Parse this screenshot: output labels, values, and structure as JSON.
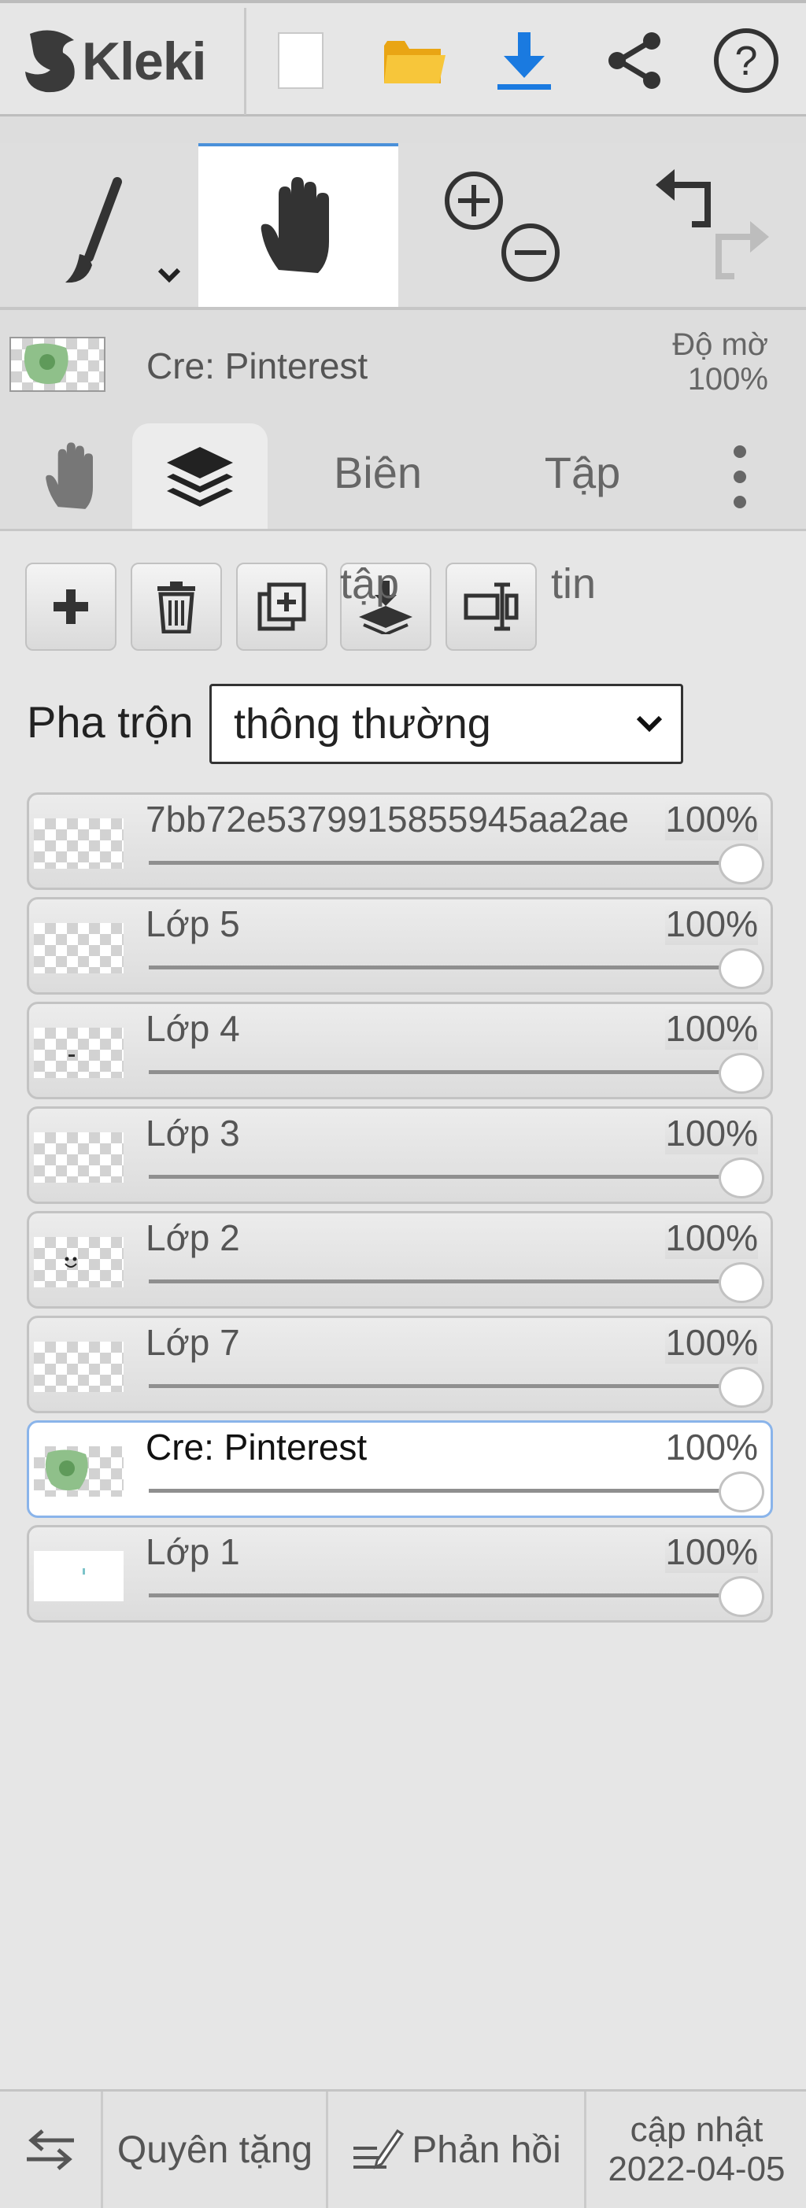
{
  "app": {
    "logo_text": "Kleki"
  },
  "current_layer": {
    "name": "Cre: Pinterest",
    "opacity_label": "Độ mờ",
    "opacity_value": "100%"
  },
  "tabs": [
    {
      "label": ""
    },
    {
      "label": ""
    },
    {
      "label": "Biên"
    },
    {
      "label": "Tập"
    }
  ],
  "tab_overflow": {
    "bien_wrap": "tập",
    "tap_wrap": "tin"
  },
  "blend": {
    "label": "Pha trộn",
    "selected": "thông thường"
  },
  "layers": [
    {
      "name": "7bb72e5379915855945aa2ae",
      "opacity": "100%",
      "opacity_value": 1.0,
      "selected": false
    },
    {
      "name": "Lớp 5",
      "opacity": "100%",
      "opacity_value": 1.0,
      "selected": false
    },
    {
      "name": "Lớp 4",
      "opacity": "100%",
      "opacity_value": 1.0,
      "selected": false
    },
    {
      "name": "Lớp 3",
      "opacity": "100%",
      "opacity_value": 1.0,
      "selected": false
    },
    {
      "name": "Lớp 2",
      "opacity": "100%",
      "opacity_value": 1.0,
      "selected": false
    },
    {
      "name": "Lớp 7",
      "opacity": "100%",
      "opacity_value": 1.0,
      "selected": false
    },
    {
      "name": "Cre: Pinterest",
      "opacity": "100%",
      "opacity_value": 1.0,
      "selected": true
    },
    {
      "name": "Lớp 1",
      "opacity": "100%",
      "opacity_value": 1.0,
      "selected": false
    }
  ],
  "footer": {
    "donate": "Quyên tặng",
    "feedback": "Phản hồi",
    "update_label": "cập nhật",
    "update_date": "2022-04-05"
  },
  "colors": {
    "accent": "#4a90d9",
    "download_blue": "#1a7ae0",
    "folder_yellow": "#f2b51f",
    "selected_layer_border": "#8ab4ea"
  }
}
